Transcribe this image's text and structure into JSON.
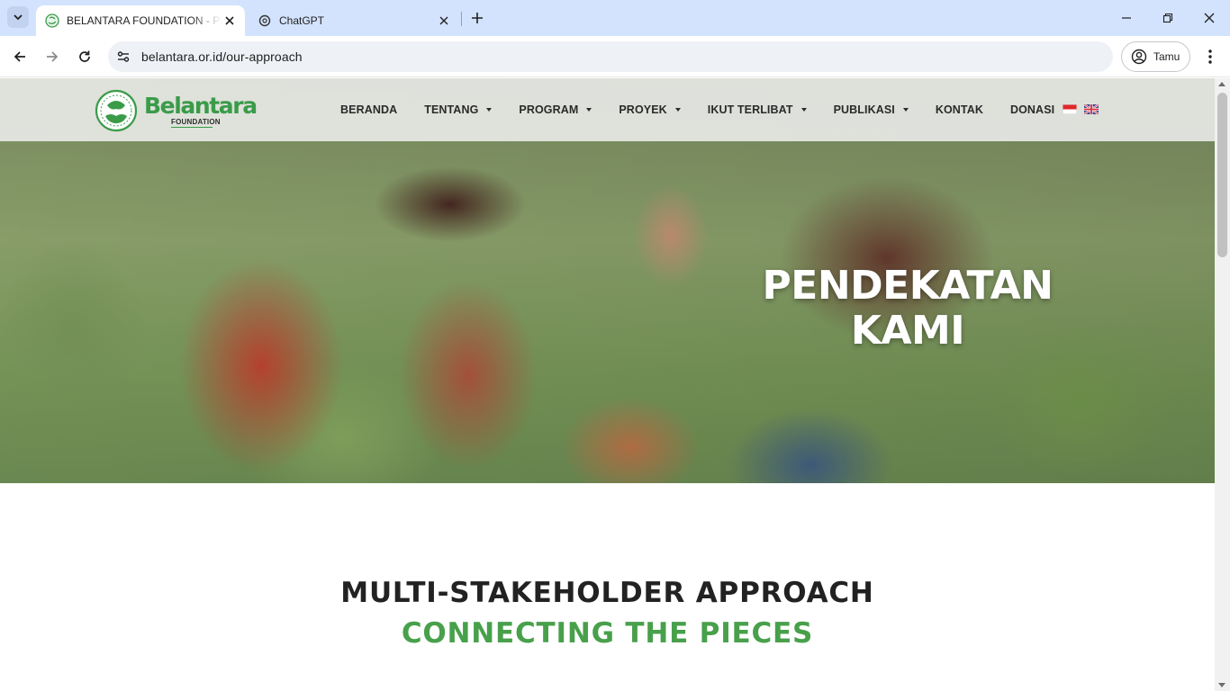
{
  "browser": {
    "tabs": [
      {
        "title": "BELANTARA FOUNDATION - PENDEKATAN KAMI",
        "active": true,
        "favicon": "belantara-favicon"
      },
      {
        "title": "ChatGPT",
        "active": false,
        "favicon": "chatgpt-favicon"
      }
    ],
    "address_bar": {
      "url": "belantara.or.id/our-approach"
    },
    "profile": {
      "label": "Tamu"
    }
  },
  "site": {
    "logo": {
      "name": "Belantara",
      "subtitle": "FOUNDATION"
    },
    "nav": [
      {
        "label": "BERANDA",
        "has_dropdown": false
      },
      {
        "label": "TENTANG",
        "has_dropdown": true
      },
      {
        "label": "PROGRAM",
        "has_dropdown": true
      },
      {
        "label": "PROYEK",
        "has_dropdown": true
      },
      {
        "label": "IKUT TERLIBAT",
        "has_dropdown": true
      },
      {
        "label": "PUBLIKASI",
        "has_dropdown": true
      },
      {
        "label": "KONTAK",
        "has_dropdown": false
      },
      {
        "label": "DONASI",
        "has_dropdown": false
      }
    ],
    "languages": [
      "id-flag-icon",
      "uk-flag-icon"
    ]
  },
  "hero": {
    "title_line1": "PENDEKATAN",
    "title_line2": "KAMI"
  },
  "section": {
    "heading_line1": "MULTI-STAKEHOLDER APPROACH",
    "heading_line2": "CONNECTING THE PIECES"
  },
  "colors": {
    "brand_green": "#3a9b49",
    "heading_green": "#48a04b",
    "tabstrip": "#d3e3fd",
    "heading_dark": "#222222"
  }
}
